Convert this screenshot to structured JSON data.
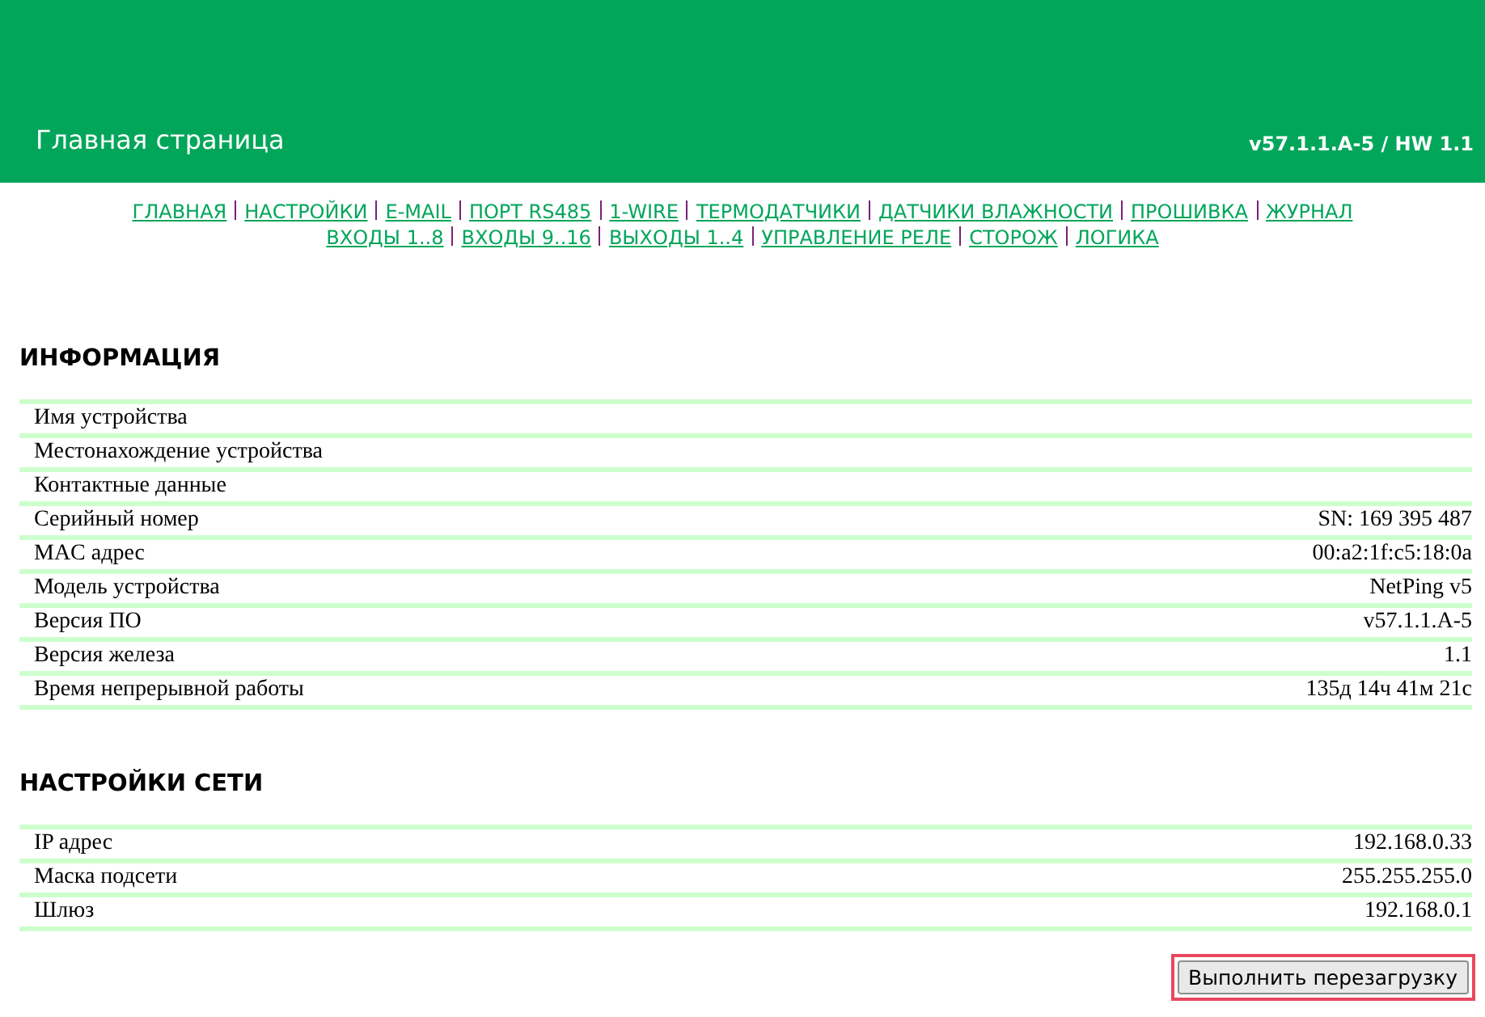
{
  "header": {
    "title": "Главная страница",
    "version": "v57.1.1.A-5 / HW 1.1"
  },
  "nav": {
    "lines": [
      [
        "ГЛАВНАЯ",
        "НАСТРОЙКИ",
        "E-MAIL",
        "ПОРТ RS485",
        "1-WIRE",
        "ТЕРМОДАТЧИКИ",
        "ДАТЧИКИ ВЛАЖНОСТИ",
        "ПРОШИВКА",
        "ЖУРНАЛ"
      ],
      [
        "ВХОДЫ 1..8",
        "ВХОДЫ 9..16",
        "ВЫХОДЫ 1..4",
        "УПРАВЛЕНИЕ РЕЛЕ",
        "СТОРОЖ",
        "ЛОГИКА"
      ]
    ]
  },
  "sections": [
    {
      "title": "ИНФОРМАЦИЯ",
      "rows": [
        {
          "label": "Имя устройства"
        },
        {
          "label": "Местонахождение устройства"
        },
        {
          "label": "Контактные данные"
        },
        {
          "label": "Серийный номер",
          "value": "SN: 169 395 487"
        },
        {
          "label": "MAC адрес",
          "value": "00:a2:1f:c5:18:0a"
        },
        {
          "label": "Модель устройства",
          "value": "NetPing v5"
        },
        {
          "label": "Версия ПО",
          "value": "v57.1.1.A-5"
        },
        {
          "label": "Версия железа",
          "value": "1.1"
        },
        {
          "label": "Время непрерывной работы",
          "value": "135д 14ч 41м 21с"
        }
      ]
    },
    {
      "title": "НАСТРОЙКИ СЕТИ",
      "rows": [
        {
          "label": "IP адрес",
          "value": "192.168.0.33"
        },
        {
          "label": "Маска подсети",
          "value": "255.255.255.0"
        },
        {
          "label": "Шлюз",
          "value": "192.168.0.1"
        }
      ]
    }
  ],
  "reboot_button": {
    "label": "Выполнить перезагрузку",
    "highlighted": true
  }
}
